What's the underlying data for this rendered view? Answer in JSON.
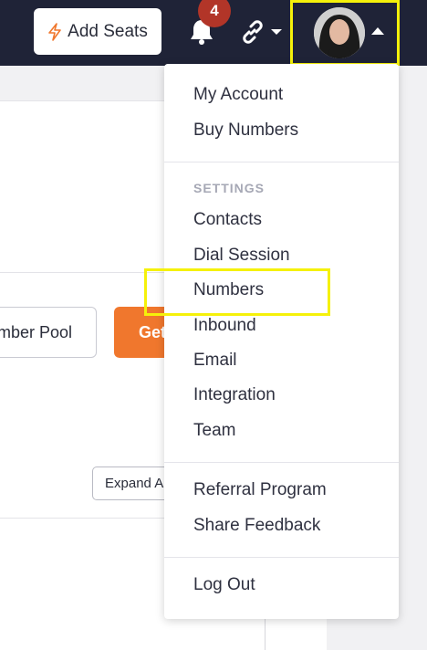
{
  "topbar": {
    "add_seats_label": "Add Seats",
    "notification_count": "4",
    "colors": {
      "bar": "#1f2337",
      "badge": "#b23528",
      "accent": "#f0772d",
      "highlight": "#f5f10a"
    }
  },
  "background": {
    "pool_button_label": "mber Pool",
    "get_button_label": "Get",
    "expand_button_label": "Expand A"
  },
  "menu": {
    "account_items": [
      "My Account",
      "Buy Numbers"
    ],
    "settings_heading": "SETTINGS",
    "settings_items": [
      "Contacts",
      "Dial Session",
      "Numbers",
      "Inbound",
      "Email",
      "Integration",
      "Team"
    ],
    "misc_items": [
      "Referral Program",
      "Share Feedback"
    ],
    "logout_label": "Log Out"
  }
}
